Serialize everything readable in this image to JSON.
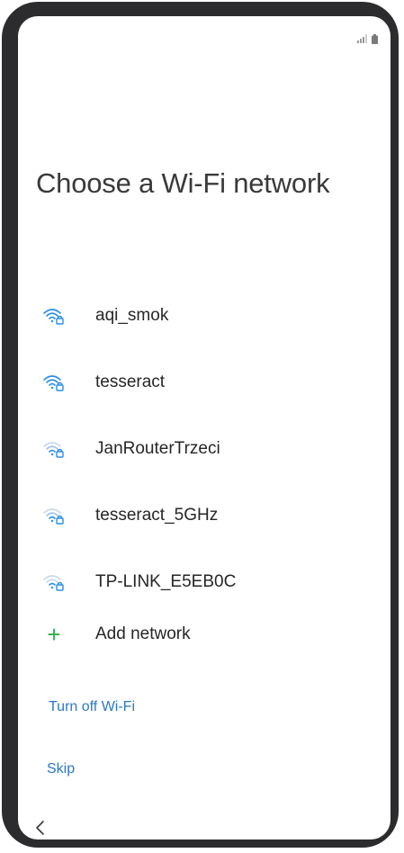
{
  "status_bar": {
    "icons": [
      "signal-icon",
      "battery-icon"
    ]
  },
  "page": {
    "title": "Choose a Wi‑Fi network"
  },
  "networks": [
    {
      "name": "aqi_smok",
      "signal": "strong",
      "secured": true
    },
    {
      "name": "tesseract",
      "signal": "strong",
      "secured": true
    },
    {
      "name": "JanRouterTrzeci",
      "signal": "weak",
      "secured": true
    },
    {
      "name": "tesseract_5GHz",
      "signal": "weak",
      "secured": true
    },
    {
      "name": "TP-LINK_E5EB0C",
      "signal": "weak",
      "secured": true
    }
  ],
  "add_network": {
    "label": "Add network",
    "icon": "plus-icon"
  },
  "actions": {
    "turn_off_wifi": "Turn off Wi-Fi",
    "skip": "Skip"
  },
  "navigation": {
    "back_icon": "chevron-left-icon"
  },
  "colors": {
    "wifi_strong": "#2a8ee8",
    "wifi_faded": "#c9d9ea",
    "accent_link": "#2a78c8",
    "add_plus": "#2bb24c"
  }
}
